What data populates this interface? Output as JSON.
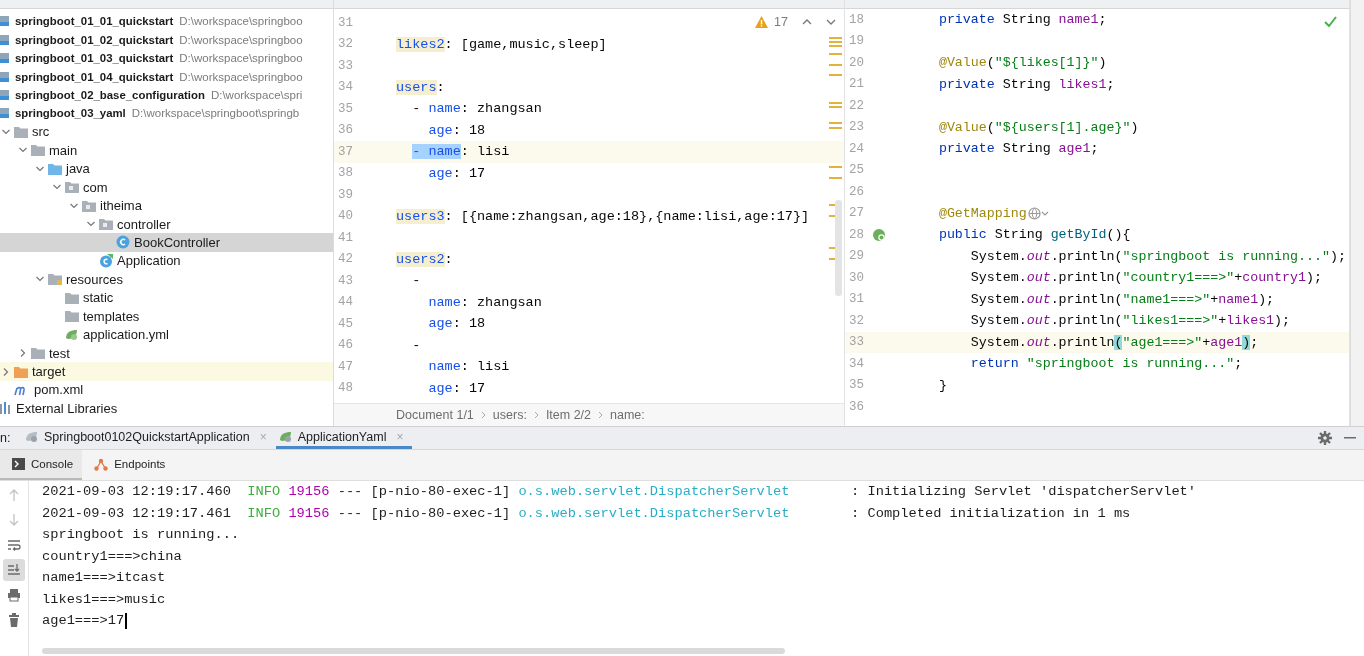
{
  "project_tree": {
    "items": [
      {
        "label": "springboot_01_01_quickstart",
        "path": "D:\\workspace\\springboo",
        "kind": "project",
        "selected": false
      },
      {
        "label": "springboot_01_02_quickstart",
        "path": "D:\\workspace\\springboo",
        "kind": "project",
        "selected": false
      },
      {
        "label": "springboot_01_03_quickstart",
        "path": "D:\\workspace\\springboo",
        "kind": "project",
        "selected": false
      },
      {
        "label": "springboot_01_04_quickstart",
        "path": "D:\\workspace\\springboo",
        "kind": "project",
        "selected": false
      },
      {
        "label": "springboot_02_base_configuration",
        "path": "D:\\workspace\\spri",
        "kind": "project",
        "selected": false
      },
      {
        "label": "springboot_03_yaml",
        "path": "D:\\workspace\\springboot\\springb",
        "kind": "project",
        "selected": false
      },
      {
        "label": "src",
        "kind": "folder",
        "expanded": true,
        "selected": false,
        "children": [
          {
            "label": "main",
            "kind": "folder",
            "expanded": true,
            "selected": false,
            "children": [
              {
                "label": "java",
                "kind": "source-folder",
                "expanded": true,
                "selected": false,
                "children": [
                  {
                    "label": "com",
                    "kind": "package",
                    "expanded": true,
                    "selected": false,
                    "children": [
                      {
                        "label": "itheima",
                        "kind": "package",
                        "expanded": true,
                        "selected": false,
                        "children": [
                          {
                            "label": "controller",
                            "kind": "package",
                            "expanded": true,
                            "selected": false,
                            "children": [
                              {
                                "label": "BookController",
                                "kind": "class",
                                "selected": true
                              }
                            ]
                          },
                          {
                            "label": "Application",
                            "kind": "app-class",
                            "selected": false
                          }
                        ]
                      }
                    ]
                  }
                ]
              },
              {
                "label": "resources",
                "kind": "resource-folder",
                "expanded": true,
                "selected": false,
                "children": [
                  {
                    "label": "static",
                    "kind": "folder",
                    "selected": false
                  },
                  {
                    "label": "templates",
                    "kind": "folder",
                    "selected": false
                  },
                  {
                    "label": "application.yml",
                    "kind": "yaml",
                    "selected": false
                  }
                ]
              }
            ]
          },
          {
            "label": "test",
            "kind": "folder",
            "expanded": false,
            "selected": false
          }
        ]
      },
      {
        "label": "target",
        "kind": "excluded-folder",
        "expanded": false,
        "selected": false
      },
      {
        "label": "pom.xml",
        "kind": "maven",
        "selected": false
      },
      {
        "label": "External Libraries",
        "kind": "libraries",
        "selected": false
      }
    ]
  },
  "yaml_editor": {
    "warnings": "17",
    "lines": [
      {
        "n": "31",
        "current": false
      },
      {
        "n": "32",
        "current": false,
        "segs": [
          {
            "t": "likes2",
            "kind": "warnkey"
          },
          {
            "t": ": [game,music,sleep]",
            "kind": "plain"
          }
        ]
      },
      {
        "n": "33",
        "current": false
      },
      {
        "n": "34",
        "current": false,
        "segs": [
          {
            "t": "users",
            "kind": "warnkey"
          },
          {
            "t": ":",
            "kind": "plain"
          }
        ]
      },
      {
        "n": "35",
        "current": false,
        "segs": [
          {
            "t": "  - ",
            "kind": "plain"
          },
          {
            "t": "name",
            "kind": "key"
          },
          {
            "t": ": zhangsan",
            "kind": "plain"
          }
        ]
      },
      {
        "n": "36",
        "current": false,
        "segs": [
          {
            "t": "    age",
            "kind": "key"
          },
          {
            "t": ": 18",
            "kind": "plain"
          }
        ]
      },
      {
        "n": "37",
        "current": true,
        "segs": [
          {
            "t": "  - name",
            "kind": "selection"
          },
          {
            "t": ": lisi",
            "kind": "plain"
          }
        ]
      },
      {
        "n": "38",
        "current": false,
        "segs": [
          {
            "t": "    age",
            "kind": "key"
          },
          {
            "t": ": 17",
            "kind": "plain"
          }
        ]
      },
      {
        "n": "39",
        "current": false
      },
      {
        "n": "40",
        "current": false,
        "segs": [
          {
            "t": "users3",
            "kind": "warnkey"
          },
          {
            "t": ": [{name:zhangsan,age:18},{name:lisi,age:17}]",
            "kind": "plain"
          }
        ]
      },
      {
        "n": "41",
        "current": false
      },
      {
        "n": "42",
        "current": false,
        "segs": [
          {
            "t": "users2",
            "kind": "warnkey"
          },
          {
            "t": ":",
            "kind": "plain"
          }
        ]
      },
      {
        "n": "43",
        "current": false,
        "segs": [
          {
            "t": "  -",
            "kind": "plain"
          }
        ]
      },
      {
        "n": "44",
        "current": false,
        "segs": [
          {
            "t": "    name",
            "kind": "key"
          },
          {
            "t": ": zhangsan",
            "kind": "plain"
          }
        ]
      },
      {
        "n": "45",
        "current": false,
        "segs": [
          {
            "t": "    age",
            "kind": "key"
          },
          {
            "t": ": 18",
            "kind": "plain"
          }
        ]
      },
      {
        "n": "46",
        "current": false,
        "segs": [
          {
            "t": "  -",
            "kind": "plain"
          }
        ]
      },
      {
        "n": "47",
        "current": false,
        "segs": [
          {
            "t": "    name",
            "kind": "key"
          },
          {
            "t": ": lisi",
            "kind": "plain"
          }
        ]
      },
      {
        "n": "48",
        "current": false,
        "segs": [
          {
            "t": "    age",
            "kind": "key"
          },
          {
            "t": ": 17",
            "kind": "plain"
          }
        ]
      }
    ]
  },
  "breadcrumb": [
    "Document 1/1",
    "users:",
    "Item 2/2",
    "name:"
  ],
  "java_editor": {
    "inspection_ok": true,
    "lines": [
      {
        "n": "18",
        "current": false,
        "segs": [
          {
            "t": "    private",
            "kind": "keyword"
          },
          {
            "t": " String ",
            "kind": "plain"
          },
          {
            "t": "name1",
            "kind": "field"
          },
          {
            "t": ";",
            "kind": "plain"
          }
        ]
      },
      {
        "n": "19",
        "current": false
      },
      {
        "n": "20",
        "current": false,
        "segs": [
          {
            "t": "    @Value",
            "kind": "annotation"
          },
          {
            "t": "(",
            "kind": "plain"
          },
          {
            "t": "\"${likes[1]}\"",
            "kind": "string"
          },
          {
            "t": ")",
            "kind": "plain"
          }
        ]
      },
      {
        "n": "21",
        "current": false,
        "segs": [
          {
            "t": "    private",
            "kind": "keyword"
          },
          {
            "t": " String ",
            "kind": "plain"
          },
          {
            "t": "likes1",
            "kind": "field"
          },
          {
            "t": ";",
            "kind": "plain"
          }
        ]
      },
      {
        "n": "22",
        "current": false
      },
      {
        "n": "23",
        "current": false,
        "segs": [
          {
            "t": "    @Value",
            "kind": "annotation"
          },
          {
            "t": "(",
            "kind": "plain"
          },
          {
            "t": "\"${users[1].age}\"",
            "kind": "string"
          },
          {
            "t": ")",
            "kind": "plain"
          }
        ]
      },
      {
        "n": "24",
        "current": false,
        "segs": [
          {
            "t": "    private",
            "kind": "keyword"
          },
          {
            "t": " String ",
            "kind": "plain"
          },
          {
            "t": "age1",
            "kind": "field"
          },
          {
            "t": ";",
            "kind": "plain"
          }
        ]
      },
      {
        "n": "25",
        "current": false
      },
      {
        "n": "26",
        "current": false
      },
      {
        "n": "27",
        "current": false,
        "segs": [
          {
            "t": "    @GetMapping",
            "kind": "annotation"
          },
          {
            "kind": "endpoint"
          }
        ]
      },
      {
        "n": "28",
        "current": false,
        "kind": "bean",
        "segs": [
          {
            "t": "    public",
            "kind": "keyword"
          },
          {
            "t": " String ",
            "kind": "plain"
          },
          {
            "t": "getById",
            "kind": "method"
          },
          {
            "t": "(){",
            "kind": "plain"
          }
        ]
      },
      {
        "n": "29",
        "current": false,
        "segs": [
          {
            "t": "        System.",
            "kind": "plain"
          },
          {
            "t": "out",
            "kind": "static"
          },
          {
            "t": ".println(",
            "kind": "plain"
          },
          {
            "t": "\"springboot is running...\"",
            "kind": "string"
          },
          {
            "t": ");",
            "kind": "plain"
          }
        ]
      },
      {
        "n": "30",
        "current": false,
        "segs": [
          {
            "t": "        System.",
            "kind": "plain"
          },
          {
            "t": "out",
            "kind": "static"
          },
          {
            "t": ".println(",
            "kind": "plain"
          },
          {
            "t": "\"country1===>\"",
            "kind": "string"
          },
          {
            "t": "+",
            "kind": "plain"
          },
          {
            "t": "country1",
            "kind": "field"
          },
          {
            "t": ");",
            "kind": "plain"
          }
        ]
      },
      {
        "n": "31",
        "current": false,
        "segs": [
          {
            "t": "        System.",
            "kind": "plain"
          },
          {
            "t": "out",
            "kind": "static"
          },
          {
            "t": ".println(",
            "kind": "plain"
          },
          {
            "t": "\"name1===>\"",
            "kind": "string"
          },
          {
            "t": "+",
            "kind": "plain"
          },
          {
            "t": "name1",
            "kind": "field"
          },
          {
            "t": ");",
            "kind": "plain"
          }
        ]
      },
      {
        "n": "32",
        "current": false,
        "segs": [
          {
            "t": "        System.",
            "kind": "plain"
          },
          {
            "t": "out",
            "kind": "static"
          },
          {
            "t": ".println(",
            "kind": "plain"
          },
          {
            "t": "\"likes1===>\"",
            "kind": "string"
          },
          {
            "t": "+",
            "kind": "plain"
          },
          {
            "t": "likes1",
            "kind": "field"
          },
          {
            "t": ");",
            "kind": "plain"
          }
        ]
      },
      {
        "n": "33",
        "current": true,
        "segs": [
          {
            "t": "        System.",
            "kind": "plain"
          },
          {
            "t": "out",
            "kind": "static"
          },
          {
            "t": ".println",
            "kind": "plain"
          },
          {
            "t": "(",
            "kind": "brace"
          },
          {
            "t": "\"age1===>\"",
            "kind": "string"
          },
          {
            "t": "+",
            "kind": "plain"
          },
          {
            "t": "age1",
            "kind": "field"
          },
          {
            "t": ")",
            "kind": "brace"
          },
          {
            "t": ";",
            "kind": "plain"
          }
        ]
      },
      {
        "n": "34",
        "current": false,
        "segs": [
          {
            "t": "        return",
            "kind": "keyword"
          },
          {
            "t": " \"springboot is running...\"",
            "kind": "string"
          },
          {
            "t": ";",
            "kind": "plain"
          }
        ]
      },
      {
        "n": "35",
        "current": false,
        "segs": [
          {
            "t": "    }",
            "kind": "plain"
          }
        ]
      },
      {
        "n": "36",
        "current": false
      }
    ]
  },
  "run_panel": {
    "label": "n:",
    "tabs": [
      {
        "label": "Springboot0102QuickstartApplication",
        "close": "×",
        "selected": false
      },
      {
        "label": "ApplicationYaml",
        "close": "×",
        "selected": true
      }
    ],
    "subtabs": [
      {
        "label": "Console",
        "kind": "console",
        "selected": true
      },
      {
        "label": "Endpoints",
        "kind": "endpoints",
        "selected": false
      }
    ],
    "toolbar": [
      {
        "kind": "up",
        "disabled": true,
        "on": false
      },
      {
        "kind": "down",
        "disabled": true,
        "on": false
      },
      {
        "kind": "wrap",
        "disabled": false,
        "on": false
      },
      {
        "kind": "scroll-end",
        "disabled": false,
        "on": true
      },
      {
        "kind": "print",
        "disabled": false,
        "on": false
      },
      {
        "kind": "trash",
        "disabled": false,
        "on": false
      }
    ],
    "lines": [
      {
        "caret": false,
        "segs": [
          {
            "t": "2021-09-03 12:19:17.460",
            "kind": "plain"
          },
          {
            "t": "INFO",
            "kind": "info"
          },
          {
            "t": "19156",
            "kind": "pid"
          },
          {
            "t": "--- [p-nio-80-exec-1]",
            "kind": "plain"
          },
          {
            "t": "o.s.web.servlet.DispatcherServlet",
            "kind": "logger"
          },
          {
            "t": ": Initializing Servlet 'dispatcherServlet'",
            "kind": "message"
          }
        ]
      },
      {
        "caret": false,
        "segs": [
          {
            "t": "2021-09-03 12:19:17.461",
            "kind": "plain"
          },
          {
            "t": "INFO",
            "kind": "info"
          },
          {
            "t": "19156",
            "kind": "pid"
          },
          {
            "t": "--- [p-nio-80-exec-1]",
            "kind": "plain"
          },
          {
            "t": "o.s.web.servlet.DispatcherServlet",
            "kind": "logger"
          },
          {
            "t": ": Completed initialization in 1 ms",
            "kind": "message"
          }
        ]
      },
      {
        "caret": false,
        "segs": [
          {
            "t": "springboot is running...",
            "kind": "plain"
          }
        ]
      },
      {
        "caret": false,
        "segs": [
          {
            "t": "country1===>china",
            "kind": "plain"
          }
        ]
      },
      {
        "caret": false,
        "segs": [
          {
            "t": "name1===>itcast",
            "kind": "plain"
          }
        ]
      },
      {
        "caret": false,
        "segs": [
          {
            "t": "likes1===>music",
            "kind": "plain"
          }
        ]
      },
      {
        "caret": true,
        "segs": [
          {
            "t": "age1===>17",
            "kind": "plain"
          }
        ]
      }
    ]
  }
}
